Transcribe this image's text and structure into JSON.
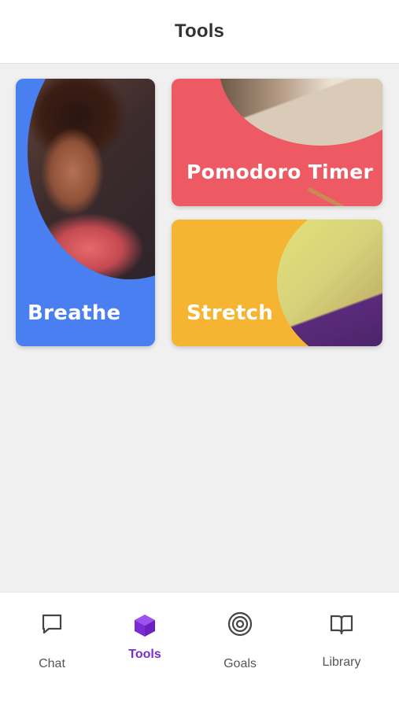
{
  "header": {
    "title": "Tools"
  },
  "cards": [
    {
      "label": "Breathe"
    },
    {
      "label": "Pomodoro Timer"
    },
    {
      "label": "Stretch"
    }
  ],
  "nav": {
    "items": [
      {
        "label": "Chat",
        "icon": "chat-bubble-icon",
        "active": false
      },
      {
        "label": "Tools",
        "icon": "cube-icon",
        "active": true
      },
      {
        "label": "Goals",
        "icon": "target-icon",
        "active": false
      },
      {
        "label": "Library",
        "icon": "book-icon",
        "active": false
      }
    ],
    "active_color": "#7b2bd4"
  },
  "colors": {
    "breathe": "#4a7ff1",
    "pomodoro": "#ee5a63",
    "stretch": "#f5b533",
    "background": "#f0f0f0"
  }
}
